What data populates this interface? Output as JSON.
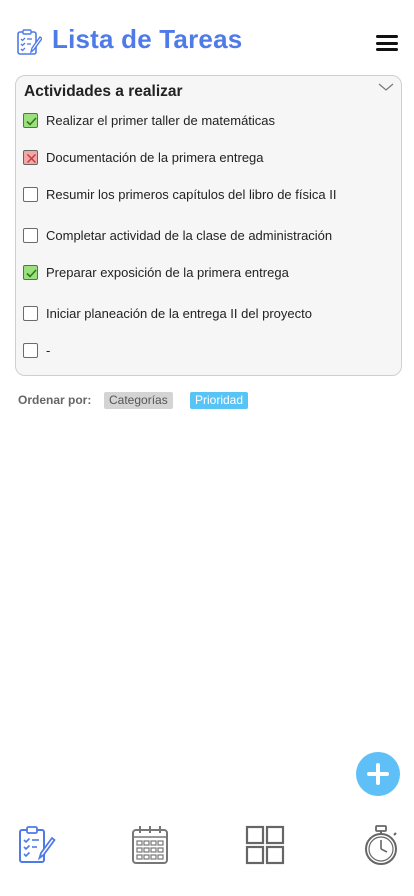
{
  "header": {
    "title": "Lista de Tareas",
    "logo_icon": "task-list-icon",
    "menu_icon": "hamburger-menu-icon"
  },
  "task_card": {
    "title": "Actividades a realizar",
    "collapse_icon": "chevron-down-icon",
    "tasks": [
      {
        "label": "Realizar el primer taller de matemáticas",
        "status": "done"
      },
      {
        "label": "Documentación de la primera entrega",
        "status": "failed"
      },
      {
        "label": "Resumir los primeros capítulos del libro de física II",
        "status": "pending"
      },
      {
        "label": "Completar actividad de la clase de administración",
        "status": "pending"
      },
      {
        "label": "Preparar exposición de la primera entrega",
        "status": "done"
      },
      {
        "label": "Iniciar planeación de la entrega II del proyecto",
        "status": "pending"
      },
      {
        "label": "-",
        "status": "pending"
      }
    ]
  },
  "sort": {
    "label": "Ordenar por:",
    "options": [
      {
        "label": "Categorías",
        "selected": false
      },
      {
        "label": "Prioridad",
        "selected": true
      }
    ]
  },
  "fab": {
    "icon": "plus-icon"
  },
  "bottom_nav": {
    "items": [
      {
        "icon": "task-list-icon"
      },
      {
        "icon": "calendar-icon"
      },
      {
        "icon": "grid-icon"
      },
      {
        "icon": "stopwatch-icon"
      }
    ]
  },
  "colors": {
    "accent": "#4f7be8",
    "fab": "#5ec0f6",
    "chip_selected": "#58c4f5",
    "done": "#9ae07c",
    "failed": "#f3a8a8"
  }
}
